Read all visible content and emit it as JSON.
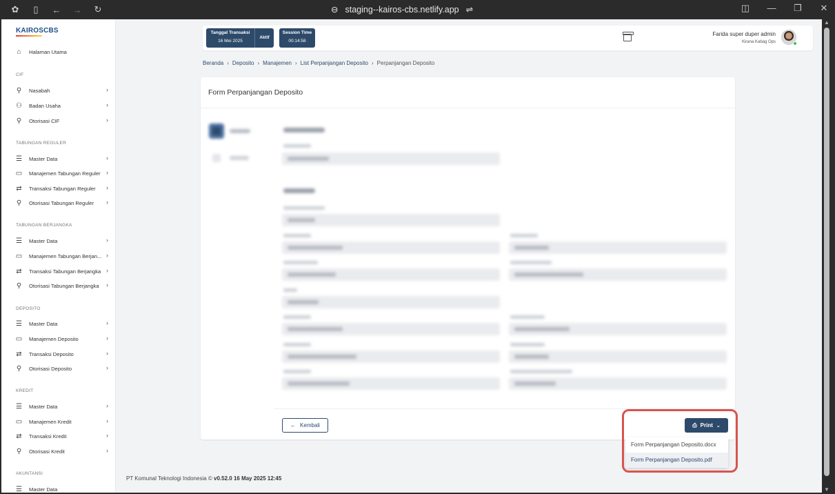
{
  "browser": {
    "url": "staging--kairos-cbs.netlify.app"
  },
  "sidebar": {
    "logo": "KAIROSCBS",
    "home": "Halaman Utama",
    "sections": [
      {
        "title": "CIF",
        "items": [
          "Nasabah",
          "Badan Usaha",
          "Otorisasi CIF"
        ]
      },
      {
        "title": "TABUNGAN REGULER",
        "items": [
          "Master Data",
          "Manajemen Tabungan Reguler",
          "Transaksi Tabungan Reguler",
          "Otorisasi Tabungan Reguler"
        ]
      },
      {
        "title": "TABUNGAN BERJANGKA",
        "items": [
          "Master Data",
          "Manajemen Tabungan Berjan...",
          "Transaksi Tabungan Berjangka",
          "Otorisasi Tabungan Berjangka"
        ]
      },
      {
        "title": "DEPOSITO",
        "items": [
          "Master Data",
          "Manajemen Deposito",
          "Transaksi Deposito",
          "Otorisasi Deposito"
        ]
      },
      {
        "title": "KREDIT",
        "items": [
          "Master Data",
          "Manajemen Kredit",
          "Transaksi Kredit",
          "Otorisasi Kredit"
        ]
      },
      {
        "title": "AKUNTANSI",
        "items": [
          "Master Data"
        ]
      }
    ]
  },
  "topbar": {
    "tgl_label": "Tanggal Transaksi",
    "tgl_value": "16 Mei 2025",
    "tgl_status": "Aktif",
    "session_label": "Session Time",
    "session_value": "00:14:58",
    "user_name": "Farida super duper admin",
    "user_role": "Kirana Kabag Ops"
  },
  "breadcrumb": [
    "Beranda",
    "Deposito",
    "Manajemen",
    "List Perpanjangan Deposito",
    "Perpanjangan Deposito"
  ],
  "card": {
    "title": "Form Perpanjangan Deposito",
    "back_label": "Kembali",
    "print_label": "Print",
    "print_options": [
      "Form Perpanjangan Deposito.docx",
      "Form Perpanjangan Deposito.pdf"
    ]
  },
  "footer": {
    "company": "PT Komunal Teknologi Indonesia ©",
    "version": "v0.52.0 16 May 2025 12:45"
  }
}
